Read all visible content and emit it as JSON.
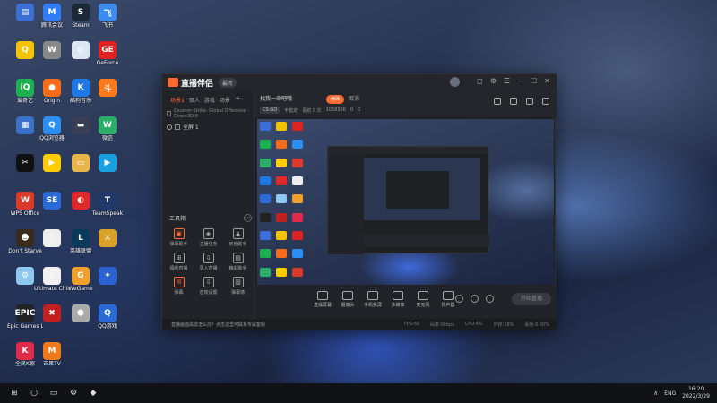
{
  "desktop": {
    "icons": [
      {
        "label": "",
        "color": "#3b6fd6",
        "glyph": "▤"
      },
      {
        "label": "腾讯会议",
        "color": "#2f7cf6",
        "glyph": "M"
      },
      {
        "label": "Steam",
        "color": "#1b2838",
        "glyph": "S"
      },
      {
        "label": "飞书",
        "color": "#3c8cf0",
        "glyph": "飞"
      },
      {
        "label": "",
        "color": "#f5c400",
        "glyph": "Q"
      },
      {
        "label": "",
        "color": "#888",
        "glyph": "W"
      },
      {
        "label": "",
        "color": "#dce6f2",
        "glyph": "◎"
      },
      {
        "label": "GeForce",
        "color": "#d22",
        "glyph": "GE"
      },
      {
        "label": "爱奇艺",
        "color": "#1cb050",
        "glyph": "iQ"
      },
      {
        "label": "Origin",
        "color": "#f56c1a",
        "glyph": "●"
      },
      {
        "label": "酷狗音乐",
        "color": "#1e78e6",
        "glyph": "K"
      },
      {
        "label": "",
        "color": "#ff7a1a",
        "glyph": "斗"
      },
      {
        "label": "",
        "color": "#3a72c8",
        "glyph": "▦"
      },
      {
        "label": "QQ浏览器",
        "color": "#2c8ef0",
        "glyph": "Q"
      },
      {
        "label": "",
        "color": "#3a3f55",
        "glyph": "▬"
      },
      {
        "label": "微信",
        "color": "#2aae67",
        "glyph": "W"
      },
      {
        "label": "",
        "color": "#111",
        "glyph": "✂"
      },
      {
        "label": "",
        "color": "#ffcc00",
        "glyph": "▶"
      },
      {
        "label": "",
        "color": "#e8b54a",
        "glyph": "▭"
      },
      {
        "label": "",
        "color": "#19a0e0",
        "glyph": "▶"
      },
      {
        "label": "WPS Office",
        "color": "#d93a2a",
        "glyph": "W"
      },
      {
        "label": "",
        "color": "#2a6ad8",
        "glyph": "SE"
      },
      {
        "label": "",
        "color": "#e02a2a",
        "glyph": "◐"
      },
      {
        "label": "TeamSpeak",
        "color": "#1f3a6a",
        "glyph": "T"
      },
      {
        "label": "Don't Starve",
        "color": "#3a2a1a",
        "glyph": "☻"
      },
      {
        "label": "",
        "color": "#eeeeee",
        "glyph": "▯"
      },
      {
        "label": "英雄联盟",
        "color": "#0a3a5a",
        "glyph": "L"
      },
      {
        "label": "",
        "color": "#d9a02a",
        "glyph": "⚔"
      },
      {
        "label": "",
        "color": "#8cc8f0",
        "glyph": "⚙"
      },
      {
        "label": "Ultimate Chicken",
        "color": "#f0f0f0",
        "glyph": "▯"
      },
      {
        "label": "WeGame",
        "color": "#f0a02a",
        "glyph": "G"
      },
      {
        "label": "",
        "color": "#2a62d2",
        "glyph": "✦"
      },
      {
        "label": "Epic Games Launcher",
        "color": "#222",
        "glyph": "EPIC"
      },
      {
        "label": "",
        "color": "#c02020",
        "glyph": "✖"
      },
      {
        "label": "",
        "color": "#aaa",
        "glyph": "⬢"
      },
      {
        "label": "QQ游戏",
        "color": "#2a6ad8",
        "glyph": "Q"
      },
      {
        "label": "全民K歌",
        "color": "#e02a4a",
        "glyph": "K"
      },
      {
        "label": "芒果TV",
        "color": "#f07a1a",
        "glyph": "M"
      }
    ]
  },
  "app": {
    "name": "直播伴侣",
    "version_badge": "最新",
    "window_controls": [
      "◻",
      "⚙",
      "☰",
      "—",
      "☐",
      "✕"
    ],
    "scene_tabs": [
      {
        "label": "场景1",
        "active": true
      },
      {
        "label": "双人",
        "active": false
      },
      {
        "label": "游戏",
        "active": false
      },
      {
        "label": "场景",
        "active": false
      }
    ],
    "scene_add": "+",
    "source_text": "Counter-Strike: Global Offensive - Direct3D 9",
    "source_item": "全屏 1",
    "tools_title": "工具箱",
    "tools_more": "···",
    "tools": [
      {
        "label": "弹幕助手",
        "glyph": "▣",
        "hot": true
      },
      {
        "label": "主播任务",
        "glyph": "◈",
        "hot": false
      },
      {
        "label": "房管助手",
        "glyph": "♟",
        "hot": false
      },
      {
        "label": "福利直播",
        "glyph": "⊞",
        "hot": false
      },
      {
        "label": "录入直播",
        "glyph": "⇩",
        "hot": false
      },
      {
        "label": "精彩助手",
        "glyph": "▤",
        "hot": false
      },
      {
        "label": "弹幕",
        "glyph": "✉",
        "hot": true
      },
      {
        "label": "音效设置",
        "glyph": "⇩",
        "hot": false
      },
      {
        "label": "弹幕墙",
        "glyph": "▥",
        "hot": false
      }
    ],
    "stream_title": "找我一命吧哦",
    "modify_btn": "修改",
    "cancel_btn": "取消",
    "game_tag": "CS:GO",
    "meta": [
      "不稳定",
      "喜欢 0 次",
      "1058300",
      "0",
      "0"
    ],
    "controls": [
      {
        "label": "直播屏幕"
      },
      {
        "label": "摄像头"
      },
      {
        "label": "手机投屏"
      },
      {
        "label": "多媒体"
      },
      {
        "label": "麦克风"
      },
      {
        "label": "扬声器"
      }
    ],
    "start_btn": "开始直播",
    "status_msg": "直播画面黑屏怎么办？点击这里可联系专属客服",
    "status_stats": [
      "FPS:60",
      "码率:0kbps",
      "CPU:4%",
      "内存:38%",
      "丢帧:0.00%"
    ]
  },
  "taskbar": {
    "icons": [
      "⊞",
      "○",
      "▭",
      "⚙",
      "◆"
    ],
    "tray_arrow": "∧",
    "lang": "ENG",
    "time": "16:20",
    "date": "2022/3/29"
  }
}
